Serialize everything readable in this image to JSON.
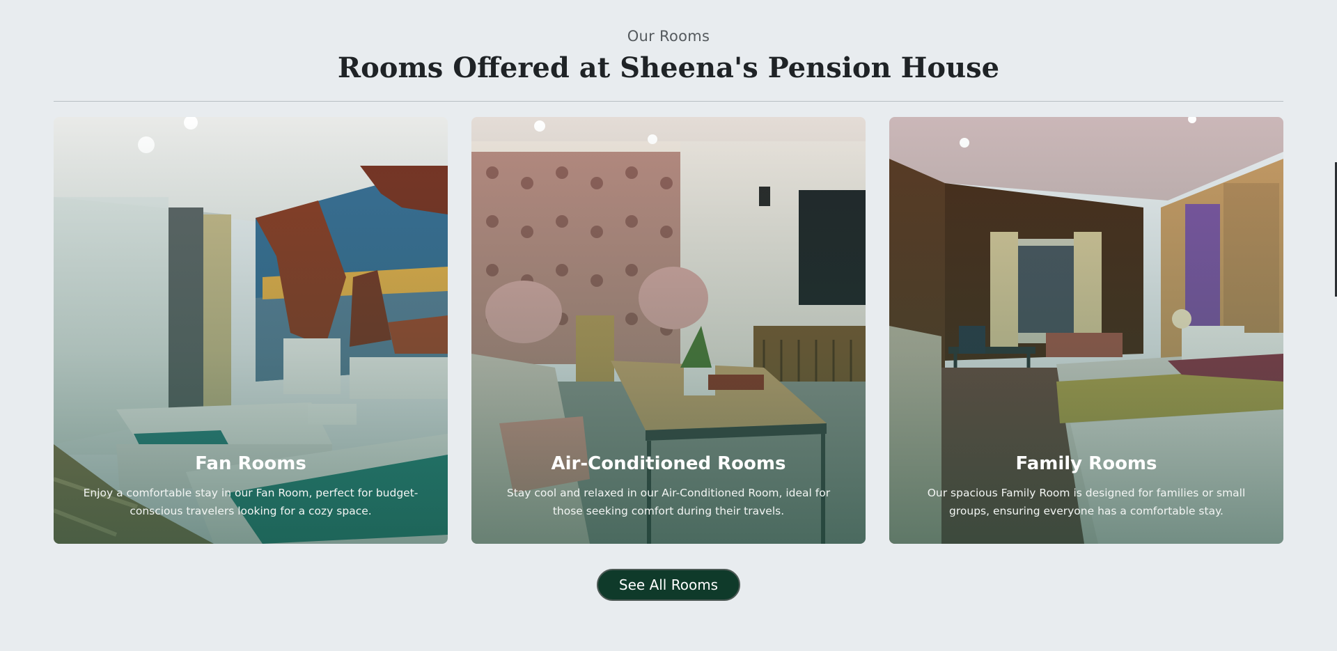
{
  "section": {
    "eyebrow": "Our Rooms",
    "title": "Rooms Offered at Sheena's Pension House"
  },
  "rooms": [
    {
      "title": "Fan Rooms",
      "description": "Enjoy a comfortable stay in our Fan Room, perfect for budget-conscious travelers looking for a cozy space."
    },
    {
      "title": "Air-Conditioned Rooms",
      "description": "Stay cool and relaxed in our Air-Conditioned Room, ideal for those seeking comfort during their travels."
    },
    {
      "title": "Family Rooms",
      "description": "Our spacious Family Room is designed for families or small groups, ensuring everyone has a comfortable stay."
    }
  ],
  "cta": {
    "label": "See All Rooms"
  },
  "colors": {
    "background": "#e8ecef",
    "button": "#0f3a2a",
    "heading": "#1f2326"
  }
}
